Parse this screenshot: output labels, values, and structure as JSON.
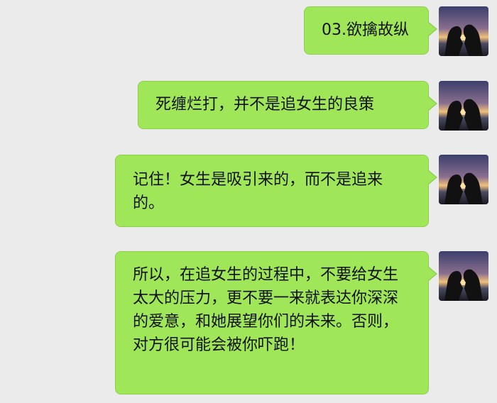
{
  "messages": [
    {
      "text": "03.欲擒故纵"
    },
    {
      "text": "死缠烂打，并不是追女生的良策"
    },
    {
      "text": "记住！女生是吸引来的，而不是追来的。"
    },
    {
      "text": "所以，在追女生的过程中，不要给女生太大的压力，更不要一来就表达你深深的爱意，和她展望你们的未来。否则，对方很可能会被你吓跑！"
    }
  ],
  "colors": {
    "bubble": "#9fe658",
    "background": "#ebebeb"
  },
  "avatar": {
    "icon": "couple-silhouette-sunset-avatar"
  }
}
